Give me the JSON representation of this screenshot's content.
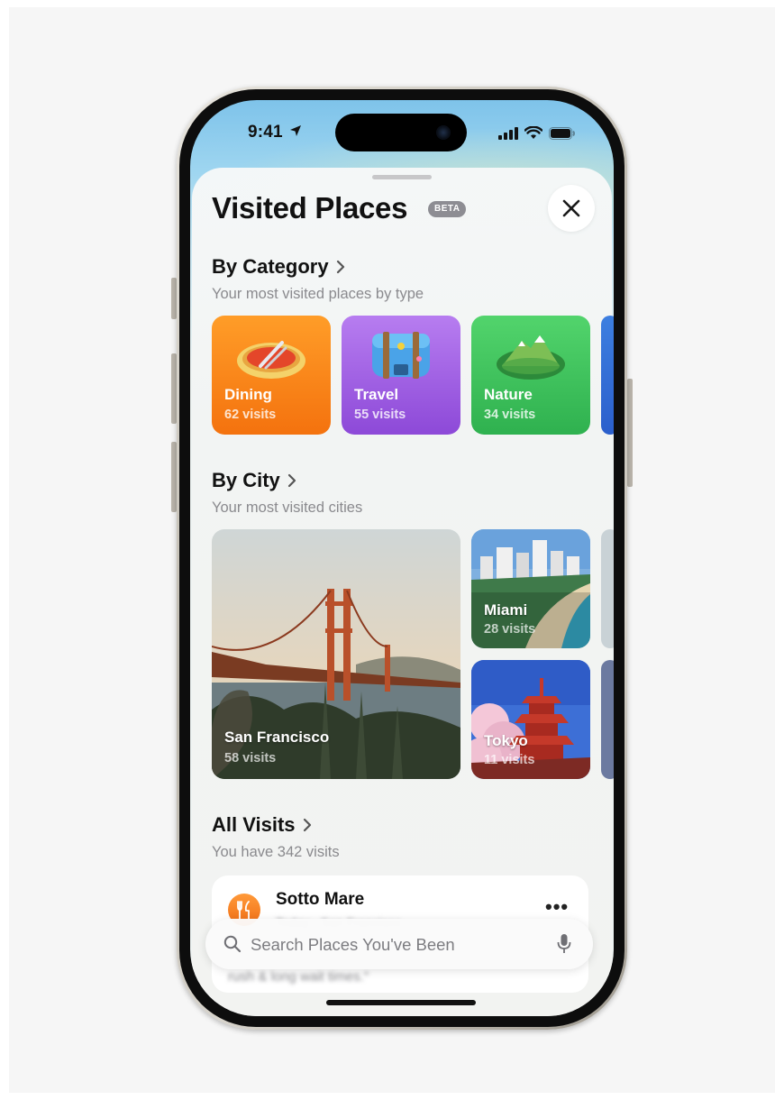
{
  "status": {
    "time": "9:41"
  },
  "header": {
    "title": "Visited Places",
    "badge": "BETA"
  },
  "by_category": {
    "title": "By Category",
    "subtitle": "Your most visited places by type",
    "items": [
      {
        "label": "Dining",
        "count": "62 visits",
        "icon": "dining-plate-icon",
        "color": "#f7820f"
      },
      {
        "label": "Travel",
        "count": "55 visits",
        "icon": "suitcase-icon",
        "color": "#a660e6"
      },
      {
        "label": "Nature",
        "count": "34 visits",
        "icon": "mountain-icon",
        "color": "#3cc35a"
      }
    ]
  },
  "by_city": {
    "title": "By City",
    "subtitle": "Your most visited cities",
    "items": [
      {
        "label": "San Francisco",
        "count": "58 visits"
      },
      {
        "label": "Miami",
        "count": "28 visits"
      },
      {
        "label": "Tokyo",
        "count": "11 visits"
      }
    ]
  },
  "all_visits": {
    "title": "All Visits",
    "subtitle": "You have 342 visits",
    "first": {
      "name": "Sotto Mare",
      "meta": "Today · San Francisco",
      "quote": "rush & long wait times.\""
    }
  },
  "search": {
    "placeholder": "Search Places You've Been"
  }
}
